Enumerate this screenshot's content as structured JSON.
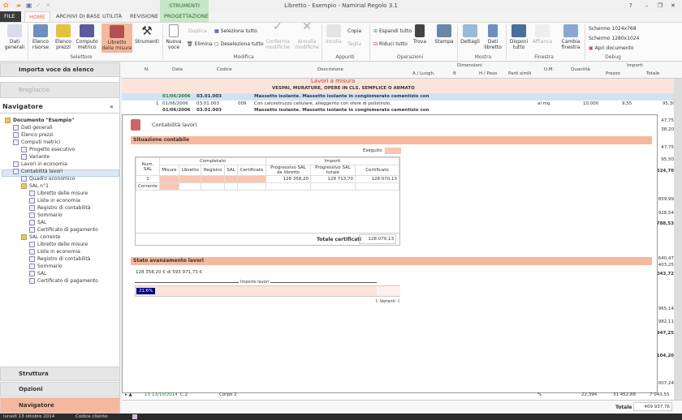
{
  "window": {
    "title": "Libretto - Esempio - Namirial Regolo 3.1",
    "help": "?",
    "minimize": "–",
    "restore": "❐",
    "close": "✕"
  },
  "context_tab": "STRUMENTI",
  "tabs": [
    "FILE",
    "HOME",
    "ARCHIVI DI BASE",
    "UTILITÀ",
    "REVISIONE",
    "PROGETTAZIONE"
  ],
  "ribbon": {
    "selettore": {
      "label": "Selettore",
      "items": [
        "Dati generali",
        "Elenco risorse",
        "Elenco prezzi",
        "Computo metrico",
        "Libretto delle misure",
        "Strumenti"
      ]
    },
    "modifica": {
      "label": "Modifica",
      "nuova": "Nuova voce",
      "duplica": "Duplica",
      "elimina": "Elimina",
      "seleziona": "Seleziona tutto",
      "deseleziona": "Deseleziona tutto",
      "conferma": "Conferma modifiche",
      "annulla": "Annulla modifiche"
    },
    "appunti": {
      "label": "Appunti",
      "incolla": "Incolla",
      "copia": "Copia",
      "taglia": "Taglia"
    },
    "operazioni": {
      "label": "Operazioni",
      "espandi": "Espandi tutto",
      "riduci": "Riduci tutto",
      "trova": "Trova",
      "stampa": "Stampa"
    },
    "mostra": {
      "label": "Mostra",
      "dettagli": "Dettagli",
      "dati": "Dati libretto"
    },
    "finestra": {
      "label": "Finestra",
      "disponi": "Disponi tutto",
      "affianca": "Affianca",
      "cambia": "Cambia finestra"
    },
    "debug": {
      "label": "Debug",
      "s1": "Schermo 1024x768",
      "s2": "Schermo 1280x1024",
      "apri": "Apri documento"
    }
  },
  "left": {
    "importa": "Importa voce da elenco",
    "brogliaccio": "Brogliaccio",
    "nav_title": "Navigatore",
    "collapse": "«",
    "tree": [
      "Documento \"Esempio\"",
      "Dati generali",
      "Elenco prezzi",
      "Computi metrici",
      "Progetto esecutivo",
      "Variante",
      "Lavori in economia",
      "Contabilità lavori",
      "Quadro economico",
      "SAL n°1",
      "Libretto delle misure",
      "Liste in economia",
      "Registro di contabilità",
      "Sommario",
      "SAL",
      "Certificato di pagamento",
      "SAL corrente",
      "Libretto delle misure",
      "Liste in economia",
      "Registro di contabilità",
      "Sommario",
      "SAL",
      "Certificato di pagamento"
    ],
    "bottom": [
      "Struttura",
      "Opzioni",
      "Navigatore"
    ]
  },
  "grid": {
    "headers": [
      "N.",
      "Data",
      "Codice",
      "Descrizione",
      "Dimensioni",
      "A / Lungh.",
      "B",
      "H / Peso",
      "Parti simili",
      "U.M.",
      "Quantità",
      "Importi",
      "Prezzo",
      "Totale"
    ],
    "rows": [
      {
        "desc": "Lavori a misura"
      },
      {
        "desc": "VESPAI, MURATURE, OPERE IN CLS. SEMPLICE O ARMATO"
      },
      {
        "data": "01/06/2006",
        "codice": "03.01.003",
        "desc": "Massetto isolante. Massetto isolante in conglomerato cementizio con"
      },
      {
        "n": "1",
        "data": "01/06/2006",
        "codice": "03.01.003",
        "sub": "009",
        "desc": "Con calcestruzzo cellulare, alleggerito con sfere di polistirolo,",
        "um": "al mq",
        "qta": "10,000",
        "prezzo": "9,55",
        "totale": "95,30"
      },
      {
        "data": "01/06/2006",
        "codice": "03.01.003",
        "desc": "Massetto isolante. Massetto isolante in conglomerato cementizio con"
      }
    ],
    "right_values": [
      "47,75",
      "38,20",
      "47,75",
      "95,50",
      "324,70",
      "859,99",
      "928,54",
      "788,53",
      "640,47",
      "403,25",
      "043,72",
      "965,14",
      "982,11",
      "947,25",
      "104,20",
      "007,24"
    ],
    "bottom_row": {
      "n": "13",
      "data": "13/10/2014",
      "codice": "C.2",
      "desc": "Corpo 2",
      "um": "%",
      "qta": "22,394",
      "prezzo": "31 452,88",
      "totale": "7 043,55"
    },
    "totale_label": "Totale",
    "totale": "409 937,76"
  },
  "panel": {
    "title": "Contabilità lavori",
    "situazione": "Situazione contabile",
    "eseguito": "Eseguito",
    "table": {
      "num_sal": "Num. SAL",
      "completato": "Completato",
      "importi": "Importi",
      "cols": [
        "Misure",
        "Libretto",
        "Registro",
        "SAL",
        "Certificato",
        "Progressivo SAL da libretto",
        "Progressivo SAL totale",
        "Certificato"
      ],
      "rows": [
        {
          "label": "1",
          "prog_libretto": "128 358,20",
          "prog_totale": "128 713,70",
          "certificato": "128 070,13"
        },
        {
          "label": "Corrente"
        }
      ],
      "totale_label": "Totale certificati",
      "totale": "128 070,13"
    },
    "stato": "Stato avanzamento lavori",
    "importo_text": "128 358,20 € di 593 971,73 €",
    "importo_lavori": "Importo lavori",
    "progress_label": "21,6%",
    "progress": 21.6,
    "varianti": "I- Varianti -I"
  },
  "status": {
    "date": "lunedì 13 ottobre 2014",
    "codice": "Codice cliente:"
  },
  "colors": {
    "accent": "#f5b89c",
    "home_tab": "#e46c3c",
    "progress": "#000080",
    "context": "#c6e8c6"
  }
}
